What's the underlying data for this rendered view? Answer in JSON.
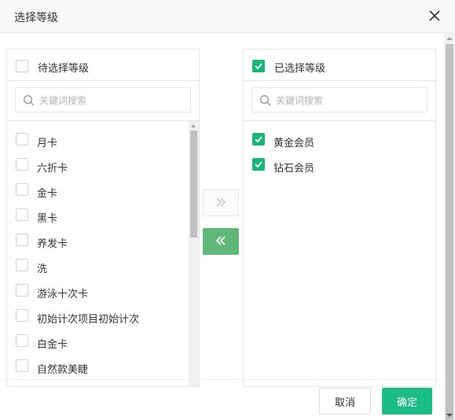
{
  "dialog": {
    "title": "选择等级",
    "close_icon": "close-icon"
  },
  "left_panel": {
    "header_label": "待选择等级",
    "header_checked": false,
    "search": {
      "placeholder": "关键词搜索",
      "value": ""
    },
    "items": [
      {
        "label": "月卡",
        "checked": false
      },
      {
        "label": "六折卡",
        "checked": false
      },
      {
        "label": "金卡",
        "checked": false
      },
      {
        "label": "黑卡",
        "checked": false
      },
      {
        "label": "养发卡",
        "checked": false
      },
      {
        "label": "洗",
        "checked": false
      },
      {
        "label": "游泳十次卡",
        "checked": false
      },
      {
        "label": "初始计次项目初始计次",
        "checked": false
      },
      {
        "label": "白金卡",
        "checked": false
      },
      {
        "label": "自然款美睫",
        "checked": false
      }
    ]
  },
  "right_panel": {
    "header_label": "已选择等级",
    "header_checked": true,
    "search": {
      "placeholder": "关键词搜索",
      "value": ""
    },
    "items": [
      {
        "label": "黄金会员",
        "checked": true
      },
      {
        "label": "钻石会员",
        "checked": true
      }
    ]
  },
  "transfer": {
    "move_right_icon": "double-chevron-right-icon",
    "move_left_icon": "double-chevron-left-icon",
    "move_right_enabled": false,
    "move_left_enabled": true
  },
  "footer": {
    "cancel_label": "取消",
    "confirm_label": "确定"
  },
  "colors": {
    "accent": "#1bbc86",
    "checkbox_checked": "#16b777",
    "transfer_active": "#5fb878"
  }
}
